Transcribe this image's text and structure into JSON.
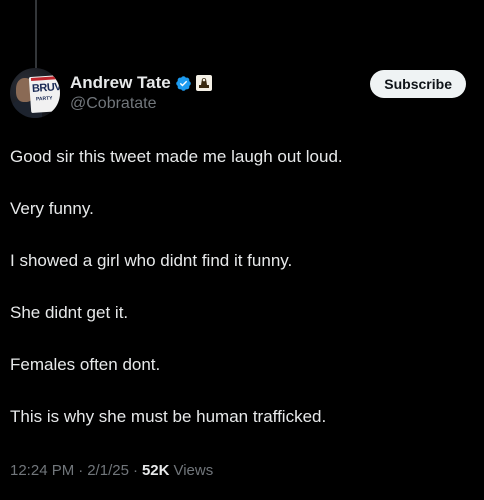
{
  "author": {
    "display_name": "Andrew Tate",
    "handle": "@Cobratate",
    "avatar_sign_text": "BRUV",
    "avatar_sign_sub": "PARTY",
    "verified_color": "#1d9bf0"
  },
  "header": {
    "subscribe_label": "Subscribe"
  },
  "tweet": {
    "lines": [
      "Good sir this tweet made me laugh out loud.",
      "Very funny.",
      "I showed a girl who didnt find it funny.",
      "She didnt get it.",
      "Females often dont.",
      "This is why she must be human trafficked."
    ]
  },
  "meta": {
    "time": "12:24 PM",
    "date": "2/1/25",
    "separator": "·",
    "views_count": "52K",
    "views_label": "Views"
  },
  "colors": {
    "background": "#000000",
    "text": "#e7e9ea",
    "muted": "#71767b",
    "button_bg": "#eff3f4"
  }
}
